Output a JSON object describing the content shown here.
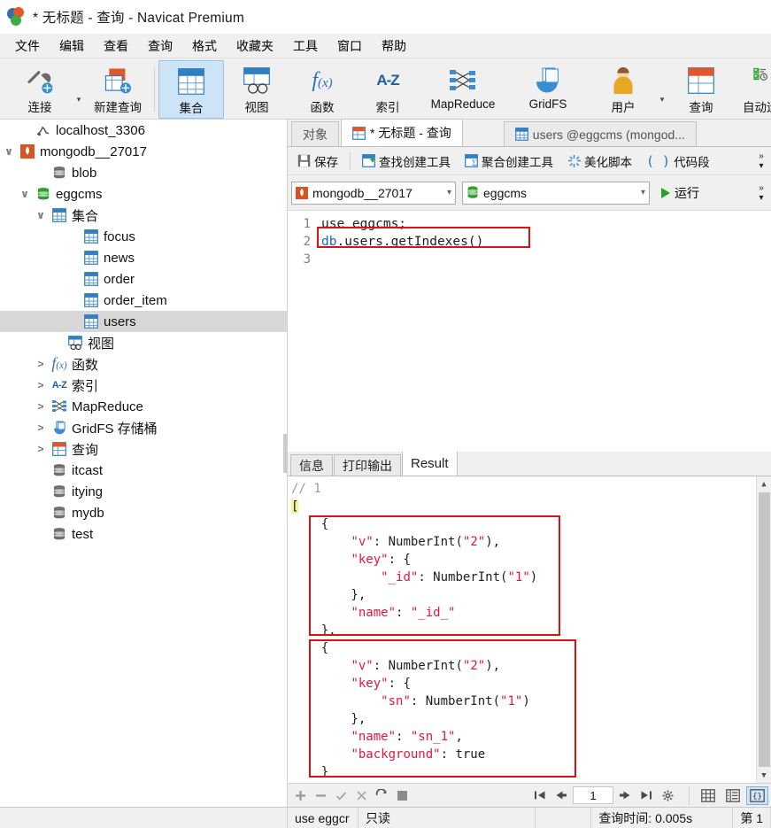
{
  "window": {
    "title": "* 无标题 - 查询 - Navicat Premium",
    "logo_icon": "navicat-logo-icon"
  },
  "menubar": {
    "items": [
      {
        "label": "文件",
        "name": "menu-file"
      },
      {
        "label": "编辑",
        "name": "menu-edit"
      },
      {
        "label": "查看",
        "name": "menu-view"
      },
      {
        "label": "查询",
        "name": "menu-query"
      },
      {
        "label": "格式",
        "name": "menu-format"
      },
      {
        "label": "收藏夹",
        "name": "menu-favorites"
      },
      {
        "label": "工具",
        "name": "menu-tools"
      },
      {
        "label": "窗口",
        "name": "menu-window"
      },
      {
        "label": "帮助",
        "name": "menu-help"
      }
    ]
  },
  "ribbon": {
    "items": [
      {
        "label": "连接",
        "icon": "connection-icon",
        "active": false
      },
      {
        "label": "新建查询",
        "icon": "new-query-icon",
        "active": false
      },
      {
        "label": "集合",
        "icon": "collection-icon",
        "active": true
      },
      {
        "label": "视图",
        "icon": "view-icon",
        "active": false
      },
      {
        "label": "函数",
        "icon": "function-icon",
        "active": false
      },
      {
        "label": "索引",
        "icon": "index-az-icon",
        "active": false
      },
      {
        "label": "MapReduce",
        "icon": "mapreduce-icon",
        "active": false
      },
      {
        "label": "GridFS",
        "icon": "gridfs-icon",
        "active": false
      },
      {
        "label": "用户",
        "icon": "user-icon",
        "active": false
      },
      {
        "label": "查询",
        "icon": "query-icon",
        "active": false
      },
      {
        "label": "自动运行",
        "icon": "autorun-icon",
        "active": false
      }
    ]
  },
  "tree": {
    "nodes": [
      {
        "label": "localhost_3306",
        "indent": 1,
        "twisty": "none",
        "icon": "mysql-conn-icon",
        "selected": false
      },
      {
        "label": "mongodb__27017",
        "indent": 0,
        "twisty": "open",
        "icon": "mongodb-conn-icon",
        "selected": false
      },
      {
        "label": "blob",
        "indent": 2,
        "twisty": "none",
        "icon": "database-grey-icon",
        "selected": false
      },
      {
        "label": "eggcms",
        "indent": 1,
        "twisty": "open",
        "icon": "database-green-icon",
        "selected": false
      },
      {
        "label": "集合",
        "indent": 2,
        "twisty": "open",
        "icon": "collection-icon",
        "selected": false
      },
      {
        "label": "focus",
        "indent": 4,
        "twisty": "none",
        "icon": "table-icon",
        "selected": false
      },
      {
        "label": "news",
        "indent": 4,
        "twisty": "none",
        "icon": "table-icon",
        "selected": false
      },
      {
        "label": "order",
        "indent": 4,
        "twisty": "none",
        "icon": "table-icon",
        "selected": false
      },
      {
        "label": "order_item",
        "indent": 4,
        "twisty": "none",
        "icon": "table-icon",
        "selected": false
      },
      {
        "label": "users",
        "indent": 4,
        "twisty": "none",
        "icon": "table-icon",
        "selected": true
      },
      {
        "label": "视图",
        "indent": 3,
        "twisty": "none",
        "icon": "view-icon",
        "selected": false
      },
      {
        "label": "函数",
        "indent": 2,
        "twisty": "closed",
        "icon": "function-icon",
        "selected": false
      },
      {
        "label": "索引",
        "indent": 2,
        "twisty": "closed",
        "icon": "index-az-icon",
        "selected": false
      },
      {
        "label": "MapReduce",
        "indent": 2,
        "twisty": "closed",
        "icon": "mapreduce-icon",
        "selected": false
      },
      {
        "label": "GridFS 存储桶",
        "indent": 2,
        "twisty": "closed",
        "icon": "gridfs-icon",
        "selected": false
      },
      {
        "label": "查询",
        "indent": 2,
        "twisty": "closed",
        "icon": "query-icon",
        "selected": false
      },
      {
        "label": "itcast",
        "indent": 2,
        "twisty": "none",
        "icon": "database-grey-icon",
        "selected": false
      },
      {
        "label": "itying",
        "indent": 2,
        "twisty": "none",
        "icon": "database-grey-icon",
        "selected": false
      },
      {
        "label": "mydb",
        "indent": 2,
        "twisty": "none",
        "icon": "database-grey-icon",
        "selected": false
      },
      {
        "label": "test",
        "indent": 2,
        "twisty": "none",
        "icon": "database-grey-icon",
        "selected": false
      }
    ]
  },
  "tabs": [
    {
      "label": "对象",
      "icon": null,
      "active": false,
      "name": "tab-objects"
    },
    {
      "label": "* 无标题 - 查询",
      "icon": "query-icon",
      "active": true,
      "name": "tab-untitled-query"
    },
    {
      "label": "users @eggcms (mongod...",
      "icon": "table-icon",
      "active": false,
      "name": "tab-users-eggcms"
    }
  ],
  "query_toolbar": {
    "buttons": [
      {
        "label": "保存",
        "icon": "save-icon",
        "name": "save-button"
      },
      {
        "label": "查找创建工具",
        "icon": "find-builder-icon",
        "name": "find-builder-button"
      },
      {
        "label": "聚合创建工具",
        "icon": "aggregate-builder-icon",
        "name": "aggregate-builder-button"
      },
      {
        "label": "美化脚本",
        "icon": "beautify-icon",
        "name": "beautify-script-button"
      },
      {
        "label": "代码段",
        "icon": "snippet-icon",
        "name": "code-snippet-button"
      }
    ],
    "overflow": "»"
  },
  "connection_bar": {
    "connection": {
      "value": "mongodb__27017",
      "icon": "mongodb-conn-icon"
    },
    "database": {
      "value": "eggcms",
      "icon": "database-green-icon"
    },
    "run_label": "运行",
    "overflow": "»"
  },
  "editor": {
    "line_numbers": [
      "1",
      "2",
      "3"
    ],
    "lines": [
      [
        {
          "t": "use eggcms;",
          "c": "plain"
        }
      ],
      [
        {
          "t": "db",
          "c": "blue"
        },
        {
          "t": ".users.getIndexes()",
          "c": "plain"
        }
      ],
      [
        {
          "t": "",
          "c": "plain"
        }
      ]
    ],
    "highlight_line": 2
  },
  "result_tabs": [
    {
      "label": "信息",
      "active": false,
      "name": "tab-info"
    },
    {
      "label": "打印输出",
      "active": false,
      "name": "tab-print-output"
    },
    {
      "label": "Result",
      "active": true,
      "name": "tab-result"
    }
  ],
  "result_json": {
    "lines": [
      [
        {
          "t": "// 1",
          "c": "comment"
        }
      ],
      [
        {
          "t": "[",
          "c": "hl"
        }
      ],
      [
        {
          "t": "    {",
          "c": "plain"
        }
      ],
      [
        {
          "t": "        ",
          "c": "plain"
        },
        {
          "t": "\"v\"",
          "c": "key"
        },
        {
          "t": ": NumberInt(",
          "c": "plain"
        },
        {
          "t": "\"2\"",
          "c": "str"
        },
        {
          "t": "),",
          "c": "plain"
        }
      ],
      [
        {
          "t": "        ",
          "c": "plain"
        },
        {
          "t": "\"key\"",
          "c": "key"
        },
        {
          "t": ": {",
          "c": "plain"
        }
      ],
      [
        {
          "t": "            ",
          "c": "plain"
        },
        {
          "t": "\"_id\"",
          "c": "key"
        },
        {
          "t": ": NumberInt(",
          "c": "plain"
        },
        {
          "t": "\"1\"",
          "c": "str"
        },
        {
          "t": ")",
          "c": "plain"
        }
      ],
      [
        {
          "t": "        },",
          "c": "plain"
        }
      ],
      [
        {
          "t": "        ",
          "c": "plain"
        },
        {
          "t": "\"name\"",
          "c": "key"
        },
        {
          "t": ": ",
          "c": "plain"
        },
        {
          "t": "\"_id_\"",
          "c": "str"
        }
      ],
      [
        {
          "t": "    },",
          "c": "plain"
        }
      ],
      [
        {
          "t": "    {",
          "c": "plain"
        }
      ],
      [
        {
          "t": "        ",
          "c": "plain"
        },
        {
          "t": "\"v\"",
          "c": "key"
        },
        {
          "t": ": NumberInt(",
          "c": "plain"
        },
        {
          "t": "\"2\"",
          "c": "str"
        },
        {
          "t": "),",
          "c": "plain"
        }
      ],
      [
        {
          "t": "        ",
          "c": "plain"
        },
        {
          "t": "\"key\"",
          "c": "key"
        },
        {
          "t": ": {",
          "c": "plain"
        }
      ],
      [
        {
          "t": "            ",
          "c": "plain"
        },
        {
          "t": "\"sn\"",
          "c": "key"
        },
        {
          "t": ": NumberInt(",
          "c": "plain"
        },
        {
          "t": "\"1\"",
          "c": "str"
        },
        {
          "t": ")",
          "c": "plain"
        }
      ],
      [
        {
          "t": "        },",
          "c": "plain"
        }
      ],
      [
        {
          "t": "        ",
          "c": "plain"
        },
        {
          "t": "\"name\"",
          "c": "key"
        },
        {
          "t": ": ",
          "c": "plain"
        },
        {
          "t": "\"sn_1\"",
          "c": "str"
        },
        {
          "t": ",",
          "c": "plain"
        }
      ],
      [
        {
          "t": "        ",
          "c": "plain"
        },
        {
          "t": "\"background\"",
          "c": "key"
        },
        {
          "t": ": true",
          "c": "plain"
        }
      ],
      [
        {
          "t": "    }",
          "c": "plain"
        }
      ],
      [
        {
          "t": "]",
          "c": "hl"
        }
      ]
    ]
  },
  "result_toolbar": {
    "edit_icons": [
      {
        "icon": "plus-icon",
        "name": "add-record-button"
      },
      {
        "icon": "minus-icon",
        "name": "delete-record-button"
      },
      {
        "icon": "check-icon",
        "name": "apply-change-button"
      },
      {
        "icon": "cross-icon",
        "name": "discard-change-button"
      },
      {
        "icon": "refresh-icon",
        "name": "refresh-button"
      },
      {
        "icon": "stop-icon",
        "name": "stop-button"
      }
    ],
    "pager": {
      "first": "first-page-icon",
      "prev": "prev-page-icon",
      "page_value": "1",
      "next": "next-page-icon",
      "last": "last-page-icon",
      "settings": "gear-icon"
    },
    "view_toggles": [
      {
        "icon": "grid-view-icon",
        "name": "grid-view-button",
        "active": false
      },
      {
        "icon": "form-view-icon",
        "name": "form-view-button",
        "active": false
      },
      {
        "icon": "json-view-icon",
        "label": "{}",
        "name": "json-view-button",
        "active": true
      }
    ]
  },
  "statusbar": {
    "cells": [
      {
        "text": "use eggcr",
        "name": "status-sql"
      },
      {
        "text": "只读",
        "name": "status-readonly"
      },
      {
        "text": "",
        "name": "status-blank"
      },
      {
        "text": "查询时间: 0.005s",
        "name": "status-query-time"
      },
      {
        "text": "第 1",
        "name": "status-row"
      }
    ]
  }
}
